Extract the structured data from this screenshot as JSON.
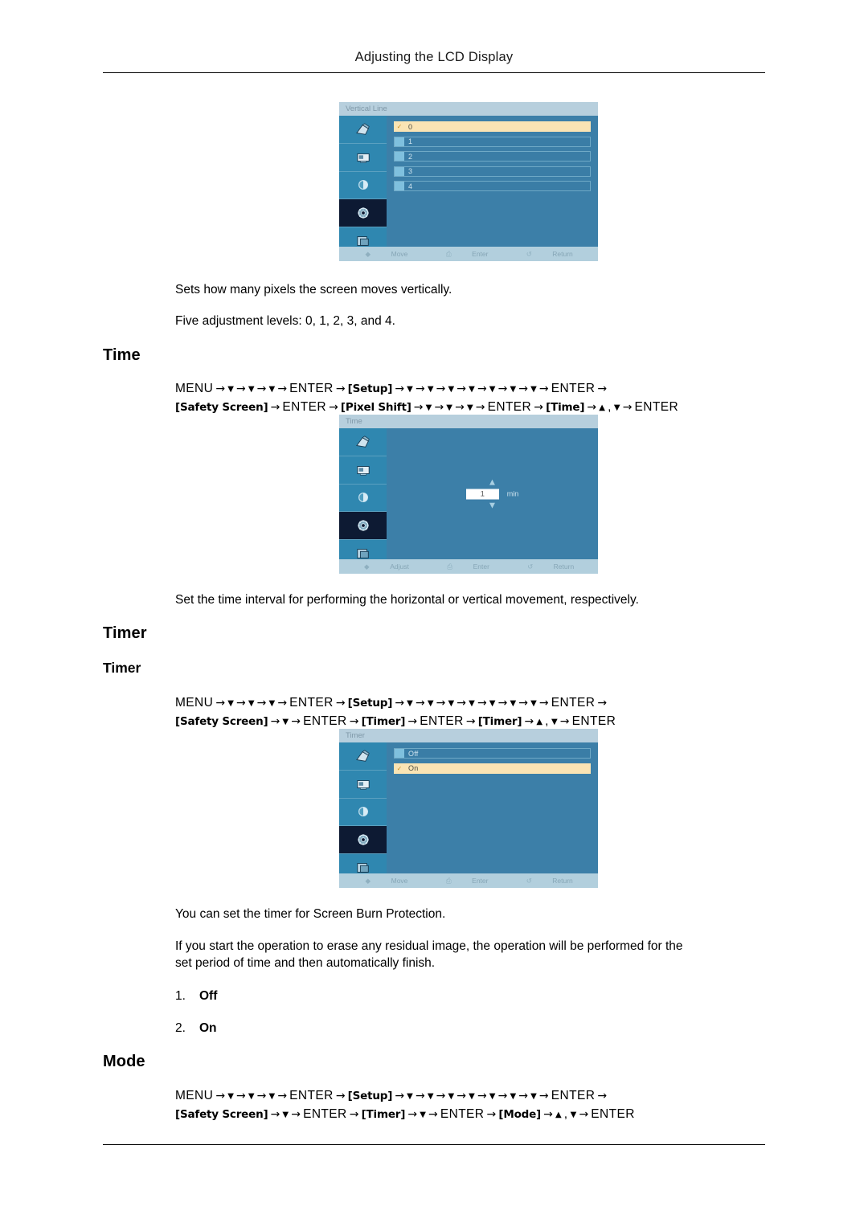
{
  "document": {
    "header_title": "Adjusting the LCD Display"
  },
  "sections": {
    "vertical_line": {
      "osd": {
        "title": "Vertical Line",
        "options": [
          "0",
          "1",
          "2",
          "3",
          "4"
        ],
        "selected_index": 0,
        "footer": [
          {
            "icon": "updown-icon",
            "label": "Move"
          },
          {
            "icon": "enter-icon",
            "label": "Enter"
          },
          {
            "icon": "return-icon",
            "label": "Return"
          }
        ],
        "sidebar_icons": [
          "picture-icon",
          "screen-icon",
          "sound-icon",
          "setup-icon",
          "multi-control-icon"
        ],
        "selected_sidebar_index": 3
      },
      "paragraph_1": "Sets how many pixels the screen moves vertically.",
      "paragraph_2": "Five adjustment levels: 0, 1, 2, 3, and 4."
    },
    "time": {
      "heading": "Time",
      "path_line_1": [
        {
          "t": "kw",
          "v": "MENU"
        },
        {
          "t": "arw",
          "v": "→"
        },
        {
          "t": "dn",
          "v": "▼"
        },
        {
          "t": "arw",
          "v": "→"
        },
        {
          "t": "dn",
          "v": "▼"
        },
        {
          "t": "arw",
          "v": "→"
        },
        {
          "t": "dn",
          "v": "▼"
        },
        {
          "t": "arw",
          "v": "→"
        },
        {
          "t": "kw",
          "v": "ENTER"
        },
        {
          "t": "arw",
          "v": "→"
        },
        {
          "t": "tok",
          "v": "[Setup]"
        },
        {
          "t": "arw",
          "v": "→"
        },
        {
          "t": "dn",
          "v": "▼"
        },
        {
          "t": "arw",
          "v": "→"
        },
        {
          "t": "dn",
          "v": "▼"
        },
        {
          "t": "arw",
          "v": "→"
        },
        {
          "t": "dn",
          "v": "▼"
        },
        {
          "t": "arw",
          "v": "→"
        },
        {
          "t": "dn",
          "v": "▼"
        },
        {
          "t": "arw",
          "v": "→"
        },
        {
          "t": "dn",
          "v": "▼"
        },
        {
          "t": "arw",
          "v": "→"
        },
        {
          "t": "dn",
          "v": "▼"
        },
        {
          "t": "arw",
          "v": "→"
        },
        {
          "t": "dn",
          "v": "▼"
        },
        {
          "t": "arw",
          "v": "→"
        },
        {
          "t": "kw",
          "v": "ENTER"
        },
        {
          "t": "arw",
          "v": "→"
        }
      ],
      "path_line_2": [
        {
          "t": "tok",
          "v": "[Safety Screen]"
        },
        {
          "t": "arw",
          "v": "→"
        },
        {
          "t": "kw",
          "v": "ENTER"
        },
        {
          "t": "arw",
          "v": "→"
        },
        {
          "t": "tok",
          "v": "[Pixel Shift]"
        },
        {
          "t": "arw",
          "v": "→"
        },
        {
          "t": "dn",
          "v": "▼"
        },
        {
          "t": "arw",
          "v": "→"
        },
        {
          "t": "dn",
          "v": "▼"
        },
        {
          "t": "arw",
          "v": "→"
        },
        {
          "t": "dn",
          "v": "▼"
        },
        {
          "t": "arw",
          "v": "→"
        },
        {
          "t": "kw",
          "v": "ENTER"
        },
        {
          "t": "arw",
          "v": "→"
        },
        {
          "t": "tok",
          "v": "[Time]"
        },
        {
          "t": "arw",
          "v": "→"
        },
        {
          "t": "up",
          "v": "▲"
        },
        {
          "t": "kw",
          "v": ","
        },
        {
          "t": "dn",
          "v": "▼"
        },
        {
          "t": "arw",
          "v": "→"
        },
        {
          "t": "kw",
          "v": "ENTER"
        }
      ],
      "osd": {
        "title": "Time",
        "value": "1",
        "unit": "min",
        "up_arrow": "▲",
        "down_arrow": "▼",
        "footer": [
          {
            "icon": "updown-icon",
            "label": "Adjust"
          },
          {
            "icon": "enter-icon",
            "label": "Enter"
          },
          {
            "icon": "return-icon",
            "label": "Return"
          }
        ],
        "sidebar_icons": [
          "picture-icon",
          "screen-icon",
          "sound-icon",
          "setup-icon",
          "multi-control-icon"
        ],
        "selected_sidebar_index": 3
      },
      "paragraph_1": "Set the time interval for performing the horizontal or vertical movement, respectively."
    },
    "timer": {
      "heading": "Timer",
      "subheading": "Timer",
      "path_line_1": [
        {
          "t": "kw",
          "v": "MENU"
        },
        {
          "t": "arw",
          "v": "→"
        },
        {
          "t": "dn",
          "v": "▼"
        },
        {
          "t": "arw",
          "v": "→"
        },
        {
          "t": "dn",
          "v": "▼"
        },
        {
          "t": "arw",
          "v": "→"
        },
        {
          "t": "dn",
          "v": "▼"
        },
        {
          "t": "arw",
          "v": "→"
        },
        {
          "t": "kw",
          "v": "ENTER"
        },
        {
          "t": "arw",
          "v": "→"
        },
        {
          "t": "tok",
          "v": "[Setup]"
        },
        {
          "t": "arw",
          "v": "→"
        },
        {
          "t": "dn",
          "v": "▼"
        },
        {
          "t": "arw",
          "v": "→"
        },
        {
          "t": "dn",
          "v": "▼"
        },
        {
          "t": "arw",
          "v": "→"
        },
        {
          "t": "dn",
          "v": "▼"
        },
        {
          "t": "arw",
          "v": "→"
        },
        {
          "t": "dn",
          "v": "▼"
        },
        {
          "t": "arw",
          "v": "→"
        },
        {
          "t": "dn",
          "v": "▼"
        },
        {
          "t": "arw",
          "v": "→"
        },
        {
          "t": "dn",
          "v": "▼"
        },
        {
          "t": "arw",
          "v": "→"
        },
        {
          "t": "dn",
          "v": "▼"
        },
        {
          "t": "arw",
          "v": "→"
        },
        {
          "t": "kw",
          "v": "ENTER"
        },
        {
          "t": "arw",
          "v": "→"
        }
      ],
      "path_line_2": [
        {
          "t": "tok",
          "v": "[Safety Screen]"
        },
        {
          "t": "arw",
          "v": "→"
        },
        {
          "t": "dn",
          "v": "▼"
        },
        {
          "t": "arw",
          "v": "→"
        },
        {
          "t": "kw",
          "v": "ENTER"
        },
        {
          "t": "arw",
          "v": "→"
        },
        {
          "t": "tok",
          "v": "[Timer]"
        },
        {
          "t": "arw",
          "v": "→"
        },
        {
          "t": "kw",
          "v": "ENTER"
        },
        {
          "t": "arw",
          "v": "→"
        },
        {
          "t": "tok",
          "v": "[Timer]"
        },
        {
          "t": "arw",
          "v": "→"
        },
        {
          "t": "up",
          "v": "▲"
        },
        {
          "t": "kw",
          "v": ","
        },
        {
          "t": "dn",
          "v": "▼"
        },
        {
          "t": "arw",
          "v": "→"
        },
        {
          "t": "kw",
          "v": "ENTER"
        }
      ],
      "osd": {
        "title": "Timer",
        "options": [
          "Off",
          "On"
        ],
        "selected_index": 1,
        "footer": [
          {
            "icon": "updown-icon",
            "label": "Move"
          },
          {
            "icon": "enter-icon",
            "label": "Enter"
          },
          {
            "icon": "return-icon",
            "label": "Return"
          }
        ],
        "sidebar_icons": [
          "picture-icon",
          "screen-icon",
          "sound-icon",
          "setup-icon",
          "multi-control-icon"
        ],
        "selected_sidebar_index": 3
      },
      "paragraph_1": "You can set the timer for Screen Burn Protection.",
      "paragraph_2_line_1": "If you start the operation to erase any residual image, the operation will be performed for the",
      "paragraph_2_line_2": "set period of time and then automatically finish.",
      "list": [
        {
          "num": "1.",
          "text": "Off"
        },
        {
          "num": "2.",
          "text": "On"
        }
      ]
    },
    "mode": {
      "heading": "Mode",
      "path_line_1": [
        {
          "t": "kw",
          "v": "MENU"
        },
        {
          "t": "arw",
          "v": "→"
        },
        {
          "t": "dn",
          "v": "▼"
        },
        {
          "t": "arw",
          "v": "→"
        },
        {
          "t": "dn",
          "v": "▼"
        },
        {
          "t": "arw",
          "v": "→"
        },
        {
          "t": "dn",
          "v": "▼"
        },
        {
          "t": "arw",
          "v": "→"
        },
        {
          "t": "kw",
          "v": "ENTER"
        },
        {
          "t": "arw",
          "v": "→"
        },
        {
          "t": "tok",
          "v": "[Setup]"
        },
        {
          "t": "arw",
          "v": "→"
        },
        {
          "t": "dn",
          "v": "▼"
        },
        {
          "t": "arw",
          "v": "→"
        },
        {
          "t": "dn",
          "v": "▼"
        },
        {
          "t": "arw",
          "v": "→"
        },
        {
          "t": "dn",
          "v": "▼"
        },
        {
          "t": "arw",
          "v": "→"
        },
        {
          "t": "dn",
          "v": "▼"
        },
        {
          "t": "arw",
          "v": "→"
        },
        {
          "t": "dn",
          "v": "▼"
        },
        {
          "t": "arw",
          "v": "→"
        },
        {
          "t": "dn",
          "v": "▼"
        },
        {
          "t": "arw",
          "v": "→"
        },
        {
          "t": "dn",
          "v": "▼"
        },
        {
          "t": "arw",
          "v": "→"
        },
        {
          "t": "kw",
          "v": "ENTER"
        },
        {
          "t": "arw",
          "v": "→"
        }
      ],
      "path_line_2": [
        {
          "t": "tok",
          "v": "[Safety Screen]"
        },
        {
          "t": "arw",
          "v": "→"
        },
        {
          "t": "dn",
          "v": "▼"
        },
        {
          "t": "arw",
          "v": "→"
        },
        {
          "t": "kw",
          "v": "ENTER"
        },
        {
          "t": "arw",
          "v": "→"
        },
        {
          "t": "tok",
          "v": "[Timer]"
        },
        {
          "t": "arw",
          "v": "→"
        },
        {
          "t": "dn",
          "v": "▼"
        },
        {
          "t": "arw",
          "v": "→"
        },
        {
          "t": "kw",
          "v": "ENTER"
        },
        {
          "t": "arw",
          "v": "→"
        },
        {
          "t": "tok",
          "v": "[Mode]"
        },
        {
          "t": "arw",
          "v": "→"
        },
        {
          "t": "up",
          "v": "▲"
        },
        {
          "t": "kw",
          "v": ","
        },
        {
          "t": "dn",
          "v": "▼"
        },
        {
          "t": "arw",
          "v": "→"
        },
        {
          "t": "kw",
          "v": "ENTER"
        }
      ]
    }
  },
  "colors": {
    "osd_body": "#3c7fa8",
    "osd_sidebar": "#2f87b0",
    "osd_selected_sidebar": "#0d1a33",
    "osd_highlight": "#fae4b4",
    "osd_titlebar": "#b7cfdd",
    "osd_footerbar": "#b2cfdd"
  }
}
